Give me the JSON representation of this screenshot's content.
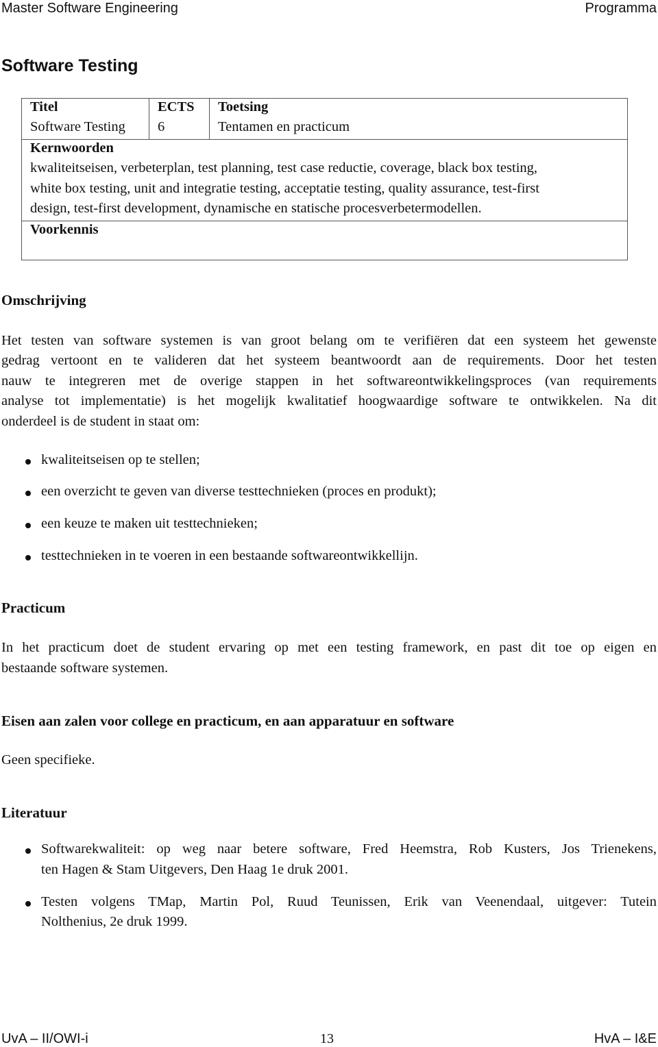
{
  "header": {
    "left": "Master Software Engineering",
    "right": "Programma"
  },
  "title": "Software Testing",
  "info_table": {
    "columns": [
      {
        "label": "Titel",
        "value": "Software Testing"
      },
      {
        "label": "ECTS",
        "value": "6"
      },
      {
        "label": "Toetsing",
        "value": "Tentamen en practicum"
      }
    ],
    "kernwoorden": {
      "label": "Kernwoorden",
      "lines": [
        "kwaliteitseisen, verbeterplan, test planning, test case reductie, coverage, black box testing,",
        "white box testing, unit and integratie testing, acceptatie testing, quality assurance, test-first",
        "design, test-first development, dynamische en statische procesverbetermodellen."
      ]
    },
    "voorkennis": {
      "label": "Voorkennis",
      "value": ""
    }
  },
  "omschrijving": {
    "heading": "Omschrijving",
    "lines": [
      "Het testen van software systemen is van groot belang om te verifiëren dat een systeem het gewenste",
      "gedrag vertoont en te valideren dat het systeem beantwoordt aan de requirements. Door het testen",
      "nauw te integreren met de overige stappen in het softwareontwikkelingsproces (van requirements",
      "analyse tot implementatie) is het mogelijk kwalitatief hoogwaardige software te ontwikkelen. Na dit",
      "onderdeel is de student in staat om:"
    ],
    "goals": [
      "kwaliteitseisen op te stellen;",
      "een overzicht te geven van diverse testtechnieken (proces en produkt);",
      "een keuze te maken uit testtechnieken;",
      "testtechnieken in te voeren in een bestaande softwareontwikkellijn."
    ]
  },
  "practicum": {
    "heading": "Practicum",
    "lines": [
      "In het practicum doet de student ervaring op met een testing framework, en past dit toe op eigen en",
      "bestaande software systemen."
    ]
  },
  "eisen": {
    "heading": "Eisen aan zalen voor college en practicum, en aan apparatuur en software",
    "text": "Geen specifieke."
  },
  "literatuur": {
    "heading": "Literatuur",
    "items": [
      {
        "lines": [
          "Softwarekwaliteit: op weg naar betere software, Fred Heemstra, Rob Kusters, Jos Trienekens,",
          "ten Hagen & Stam Uitgevers, Den Haag 1e druk 2001."
        ]
      },
      {
        "lines": [
          "Testen volgens TMap, Martin Pol, Ruud Teunissen, Erik van Veenendaal, uitgever: Tutein",
          "Nolthenius, 2e druk 1999."
        ]
      }
    ]
  },
  "footer": {
    "left": "UvA – II/OWI-i",
    "center": "13",
    "right": "HvA – I&E"
  }
}
